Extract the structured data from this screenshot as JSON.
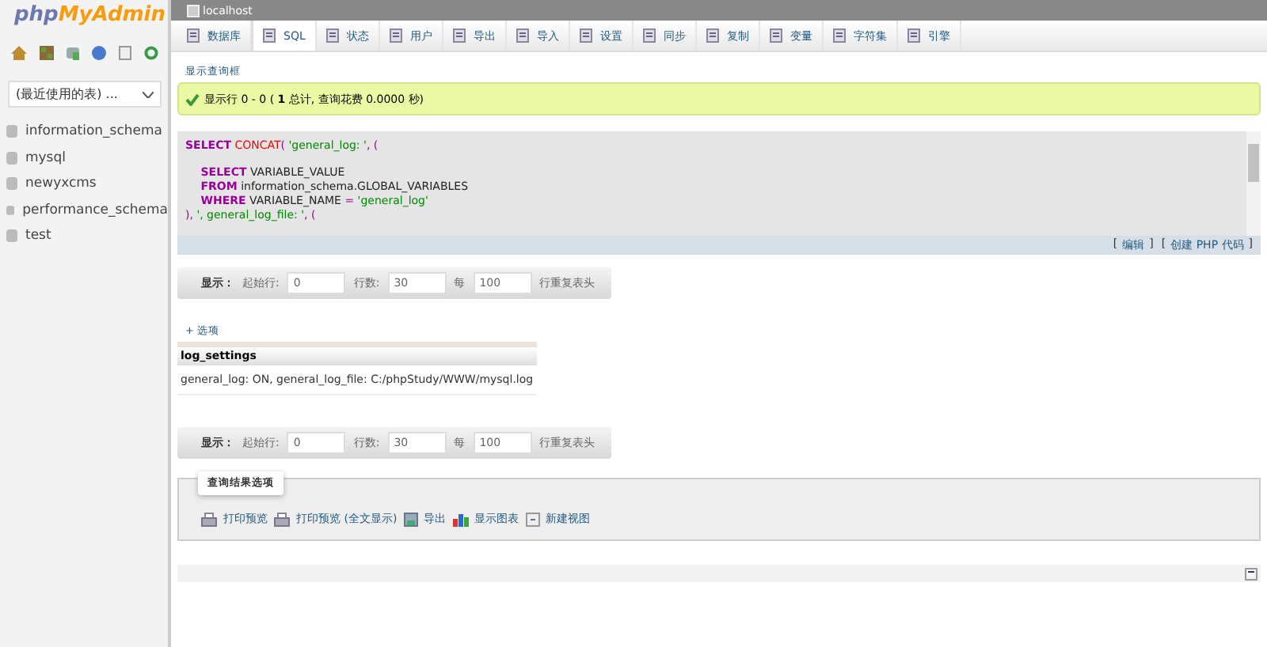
{
  "logo": {
    "part1": "php",
    "part2": "MyAdmin"
  },
  "sidebar": {
    "recent_select": {
      "value": "(最近使用的表) ..."
    },
    "databases": [
      {
        "name": "information_schema"
      },
      {
        "name": "mysql"
      },
      {
        "name": "newyxcms"
      },
      {
        "name": "performance_schema"
      },
      {
        "name": "test"
      }
    ]
  },
  "server_title": "localhost",
  "tabs": [
    {
      "label": "数据库",
      "selected": false
    },
    {
      "label": "SQL",
      "selected": true
    },
    {
      "label": "状态",
      "selected": false
    },
    {
      "label": "用户",
      "selected": false
    },
    {
      "label": "导出",
      "selected": false
    },
    {
      "label": "导入",
      "selected": false
    },
    {
      "label": "设置",
      "selected": false
    },
    {
      "label": "同步",
      "selected": false
    },
    {
      "label": "复制",
      "selected": false
    },
    {
      "label": "变量",
      "selected": false
    },
    {
      "label": "字符集",
      "selected": false
    },
    {
      "label": "引擎",
      "selected": false
    }
  ],
  "show_query_link": "显示查询框",
  "success_message": "显示行 0 - 0 ( **1** 总计, 查询花费 0.0000 秒)",
  "sql_lines": [
    {
      "kind": "code",
      "tokens": [
        {
          "kind": "keyword",
          "text": "SELECT"
        },
        {
          "kind": "function",
          "text": " CONCAT"
        },
        {
          "kind": "punct",
          "text": "( "
        },
        {
          "kind": "string",
          "text": "'general_log: '"
        },
        {
          "kind": "punct",
          "text": ", ("
        }
      ]
    },
    {
      "kind": "blank"
    },
    {
      "kind": "code",
      "tokens": [
        {
          "kind": "keyword",
          "text": "    SELECT"
        },
        {
          "kind": "plain",
          "text": " VARIABLE_VALUE"
        }
      ]
    },
    {
      "kind": "code",
      "tokens": [
        {
          "kind": "keyword",
          "text": "    FROM"
        },
        {
          "kind": "plain",
          "text": " information_schema.GLOBAL_VARIABLES"
        }
      ]
    },
    {
      "kind": "code",
      "tokens": [
        {
          "kind": "keyword",
          "text": "    WHERE"
        },
        {
          "kind": "plain",
          "text": " VARIABLE_NAME "
        },
        {
          "kind": "punct",
          "text": "="
        },
        {
          "kind": "string",
          "text": " 'general_log'"
        }
      ]
    },
    {
      "kind": "code",
      "tokens": [
        {
          "kind": "punct",
          "text": "), "
        },
        {
          "kind": "string",
          "text": "', general_log_file: '"
        },
        {
          "kind": "punct",
          "text": ", ("
        }
      ]
    }
  ],
  "sql_links": [
    {
      "open": "[",
      "label": "编辑",
      "close": "]"
    },
    {
      "open": "[",
      "label": "创建 PHP 代码",
      "close": "]"
    }
  ],
  "navigation_bars": [
    {
      "label": "显示：",
      "start_label": "起始行:",
      "start_value": "0",
      "rows_label": "行数:",
      "rows_value": "30",
      "repeat_label": "每",
      "repeat_value": "100",
      "repeat_suffix": "行重复表头"
    },
    {
      "label": "显示：",
      "start_label": "起始行:",
      "start_value": "0",
      "rows_label": "行数:",
      "rows_value": "30",
      "repeat_label": "每",
      "repeat_value": "100",
      "repeat_suffix": "行重复表头"
    }
  ],
  "options_link": "+ 选项",
  "result_table": {
    "columns": [
      "log_settings"
    ],
    "rows": [
      [
        "general_log: ON, general_log_file: C:/phpStudy/WWW/mysql.log"
      ]
    ]
  },
  "result_options": {
    "legend": "查询结果选项",
    "actions": [
      {
        "kind": "print",
        "label": "打印预览"
      },
      {
        "kind": "print",
        "label": "打印预览 (全文显示)"
      },
      {
        "kind": "export",
        "label": "导出"
      },
      {
        "kind": "chart",
        "label": "显示图表"
      },
      {
        "kind": "view",
        "label": "新建视图"
      }
    ]
  }
}
